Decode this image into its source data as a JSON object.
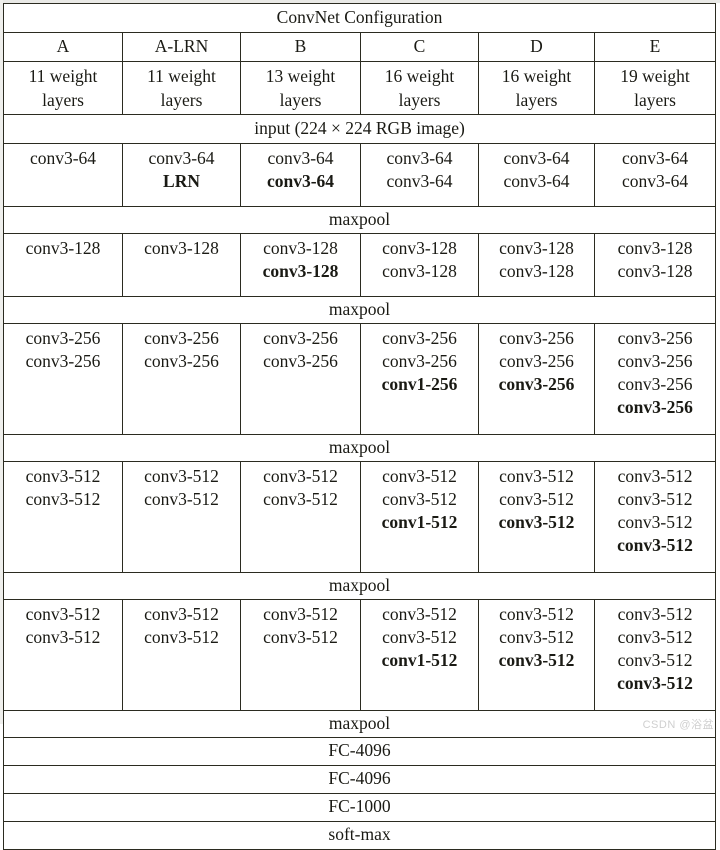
{
  "document": {
    "title": "ConvNet Configuration",
    "watermark": "CSDN @浴盆"
  },
  "table": {
    "title": "ConvNet Configuration",
    "column_names": [
      "A",
      "A-LRN",
      "B",
      "C",
      "D",
      "E"
    ],
    "column_descriptions": [
      [
        "11 weight",
        "layers"
      ],
      [
        "11 weight",
        "layers"
      ],
      [
        "13 weight",
        "layers"
      ],
      [
        "16 weight",
        "layers"
      ],
      [
        "16 weight",
        "layers"
      ],
      [
        "19 weight",
        "layers"
      ]
    ],
    "input_row": "input (224 × 224 RGB image)",
    "pool_label": "maxpool",
    "fc_rows": [
      "FC-4096",
      "FC-4096",
      "FC-1000",
      "soft-max"
    ],
    "blocks": [
      {
        "name": "conv-64-block",
        "columns": [
          [
            {
              "text": "conv3-64",
              "bold": false
            }
          ],
          [
            {
              "text": "conv3-64",
              "bold": false
            },
            {
              "text": "LRN",
              "bold": true
            }
          ],
          [
            {
              "text": "conv3-64",
              "bold": false
            },
            {
              "text": "conv3-64",
              "bold": true
            }
          ],
          [
            {
              "text": "conv3-64",
              "bold": false
            },
            {
              "text": "conv3-64",
              "bold": false
            }
          ],
          [
            {
              "text": "conv3-64",
              "bold": false
            },
            {
              "text": "conv3-64",
              "bold": false
            }
          ],
          [
            {
              "text": "conv3-64",
              "bold": false
            },
            {
              "text": "conv3-64",
              "bold": false
            }
          ]
        ]
      },
      {
        "name": "conv-128-block",
        "columns": [
          [
            {
              "text": "conv3-128",
              "bold": false
            }
          ],
          [
            {
              "text": "conv3-128",
              "bold": false
            }
          ],
          [
            {
              "text": "conv3-128",
              "bold": false
            },
            {
              "text": "conv3-128",
              "bold": true
            }
          ],
          [
            {
              "text": "conv3-128",
              "bold": false
            },
            {
              "text": "conv3-128",
              "bold": false
            }
          ],
          [
            {
              "text": "conv3-128",
              "bold": false
            },
            {
              "text": "conv3-128",
              "bold": false
            }
          ],
          [
            {
              "text": "conv3-128",
              "bold": false
            },
            {
              "text": "conv3-128",
              "bold": false
            }
          ]
        ]
      },
      {
        "name": "conv-256-block",
        "columns": [
          [
            {
              "text": "conv3-256",
              "bold": false
            },
            {
              "text": "conv3-256",
              "bold": false
            }
          ],
          [
            {
              "text": "conv3-256",
              "bold": false
            },
            {
              "text": "conv3-256",
              "bold": false
            }
          ],
          [
            {
              "text": "conv3-256",
              "bold": false
            },
            {
              "text": "conv3-256",
              "bold": false
            }
          ],
          [
            {
              "text": "conv3-256",
              "bold": false
            },
            {
              "text": "conv3-256",
              "bold": false
            },
            {
              "text": "conv1-256",
              "bold": true
            }
          ],
          [
            {
              "text": "conv3-256",
              "bold": false
            },
            {
              "text": "conv3-256",
              "bold": false
            },
            {
              "text": "conv3-256",
              "bold": true
            }
          ],
          [
            {
              "text": "conv3-256",
              "bold": false
            },
            {
              "text": "conv3-256",
              "bold": false
            },
            {
              "text": "conv3-256",
              "bold": false
            },
            {
              "text": "conv3-256",
              "bold": true
            }
          ]
        ]
      },
      {
        "name": "conv-512-block-1",
        "columns": [
          [
            {
              "text": "conv3-512",
              "bold": false
            },
            {
              "text": "conv3-512",
              "bold": false
            }
          ],
          [
            {
              "text": "conv3-512",
              "bold": false
            },
            {
              "text": "conv3-512",
              "bold": false
            }
          ],
          [
            {
              "text": "conv3-512",
              "bold": false
            },
            {
              "text": "conv3-512",
              "bold": false
            }
          ],
          [
            {
              "text": "conv3-512",
              "bold": false
            },
            {
              "text": "conv3-512",
              "bold": false
            },
            {
              "text": "conv1-512",
              "bold": true
            }
          ],
          [
            {
              "text": "conv3-512",
              "bold": false
            },
            {
              "text": "conv3-512",
              "bold": false
            },
            {
              "text": "conv3-512",
              "bold": true
            }
          ],
          [
            {
              "text": "conv3-512",
              "bold": false
            },
            {
              "text": "conv3-512",
              "bold": false
            },
            {
              "text": "conv3-512",
              "bold": false
            },
            {
              "text": "conv3-512",
              "bold": true
            }
          ]
        ]
      },
      {
        "name": "conv-512-block-2",
        "columns": [
          [
            {
              "text": "conv3-512",
              "bold": false
            },
            {
              "text": "conv3-512",
              "bold": false
            }
          ],
          [
            {
              "text": "conv3-512",
              "bold": false
            },
            {
              "text": "conv3-512",
              "bold": false
            }
          ],
          [
            {
              "text": "conv3-512",
              "bold": false
            },
            {
              "text": "conv3-512",
              "bold": false
            }
          ],
          [
            {
              "text": "conv3-512",
              "bold": false
            },
            {
              "text": "conv3-512",
              "bold": false
            },
            {
              "text": "conv1-512",
              "bold": true
            }
          ],
          [
            {
              "text": "conv3-512",
              "bold": false
            },
            {
              "text": "conv3-512",
              "bold": false
            },
            {
              "text": "conv3-512",
              "bold": true
            }
          ],
          [
            {
              "text": "conv3-512",
              "bold": false
            },
            {
              "text": "conv3-512",
              "bold": false
            },
            {
              "text": "conv3-512",
              "bold": false
            },
            {
              "text": "conv3-512",
              "bold": true
            }
          ]
        ]
      }
    ]
  }
}
